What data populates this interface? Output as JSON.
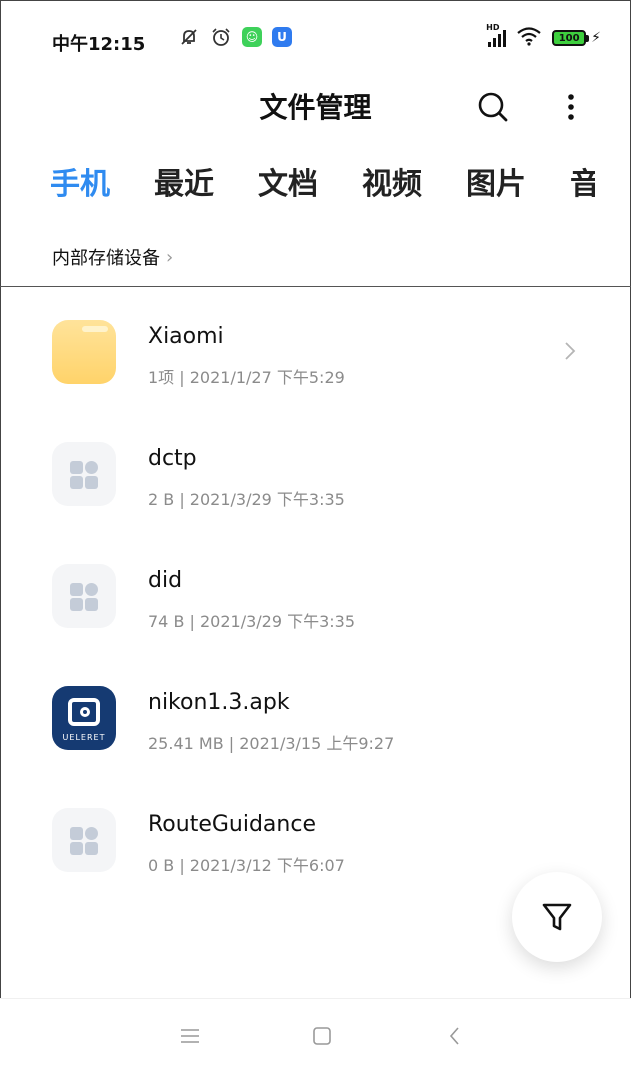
{
  "status_bar": {
    "time": "中午12:15",
    "battery_level": "100",
    "signal_label": "HD",
    "icons": [
      "mute-icon",
      "alarm-icon",
      "app-notification-green-icon",
      "app-notification-blue-icon",
      "signal-icon",
      "wifi-icon",
      "battery-icon",
      "charging-icon"
    ]
  },
  "header": {
    "title": "文件管理",
    "search_icon": "search-icon",
    "more_icon": "more-vertical-icon"
  },
  "tabs": [
    {
      "label": "手机",
      "active": true
    },
    {
      "label": "最近",
      "active": false
    },
    {
      "label": "文档",
      "active": false
    },
    {
      "label": "视频",
      "active": false
    },
    {
      "label": "图片",
      "active": false
    },
    {
      "label": "音",
      "active": false
    }
  ],
  "breadcrumb": {
    "label": "内部存储设备",
    "chevron": "›"
  },
  "files": [
    {
      "name": "Xiaomi",
      "meta": "1项 | 2021/1/27 下午5:29",
      "icon": "folder-icon"
    },
    {
      "name": "dctp",
      "meta": "2 B | 2021/3/29 下午3:35",
      "icon": "unknown-file-icon"
    },
    {
      "name": "did",
      "meta": "74 B | 2021/3/29 下午3:35",
      "icon": "unknown-file-icon"
    },
    {
      "name": "nikon1.3.apk",
      "meta": "25.41 MB | 2021/3/15 上午9:27",
      "icon": "apk-app-icon",
      "brand": "UELERET"
    },
    {
      "name": "RouteGuidance",
      "meta": "0 B | 2021/3/12 下午6:07",
      "icon": "unknown-file-icon"
    }
  ],
  "fab": {
    "icon": "filter-icon"
  },
  "nav_bar": {
    "icons": [
      "menu-icon",
      "home-icon",
      "back-icon"
    ]
  },
  "colors": {
    "accent": "#2f8bf0",
    "folder": "#ffd36a",
    "apk": "#153a72",
    "battery": "#3ecf3e"
  }
}
